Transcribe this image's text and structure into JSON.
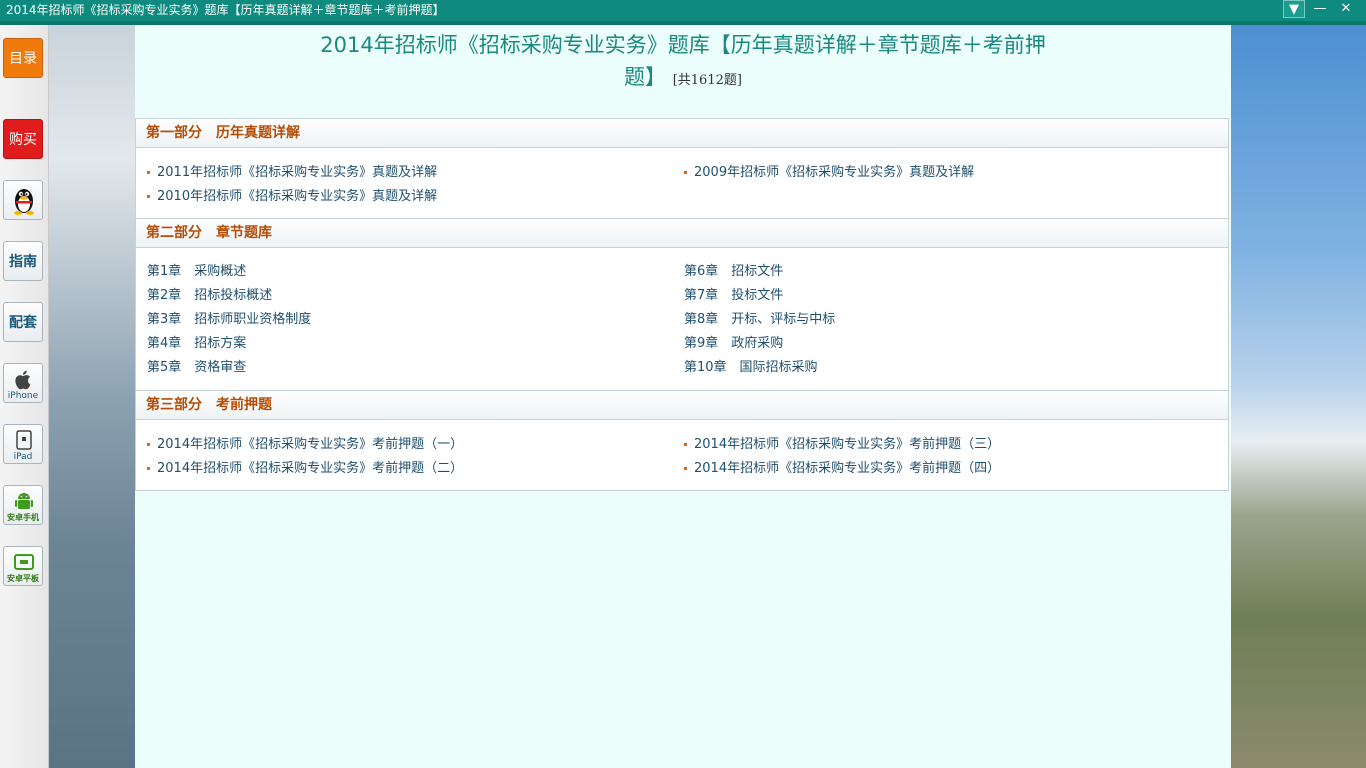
{
  "window": {
    "title": "2014年招标师《招标采购专业实务》题库【历年真题详解＋章节题库＋考前押题】",
    "menu_icon": "▼",
    "minimize_icon": "—",
    "close_icon": "✕"
  },
  "toolbar": {
    "catalog": "目录",
    "buy": "购买",
    "qq_icon": "qq-penguin-icon",
    "guide": "指南",
    "bundle": "配套",
    "iphone": "iPhone",
    "ipad": "iPad",
    "android_phone": "安卓手机",
    "android_tablet": "安卓平板"
  },
  "header": {
    "title_line1": "2014年招标师《招标采购专业实务》题库【历年真题详解＋章节题库＋考前押",
    "title_line2": "题】",
    "count": "[共1612题]"
  },
  "sections": [
    {
      "heading": "第一部分　历年真题详解",
      "items": [
        "2011年招标师《招标采购专业实务》真题及详解",
        "2009年招标师《招标采购专业实务》真题及详解",
        "2010年招标师《招标采购专业实务》真题及详解"
      ]
    },
    {
      "heading": "第二部分　章节题库",
      "items": [
        "第1章　采购概述",
        "第6章　招标文件",
        "第2章　招标投标概述",
        "第7章　投标文件",
        "第3章　招标师职业资格制度",
        "第8章　开标、评标与中标",
        "第4章　招标方案",
        "第9章　政府采购",
        "第5章　资格审查",
        "第10章　国际招标采购"
      ]
    },
    {
      "heading": "第三部分　考前押题",
      "items": [
        "2014年招标师《招标采购专业实务》考前押题（一）",
        "2014年招标师《招标采购专业实务》考前押题（三）",
        "2014年招标师《招标采购专业实务》考前押题（二）",
        "2014年招标师《招标采购专业实务》考前押题（四）"
      ]
    }
  ],
  "colors": {
    "titlebar": "#0e8a7e",
    "title_text": "#19897f",
    "section_heading": "#b54d06",
    "link_text": "#1f4f6e",
    "panel_bg": "#ecfefc"
  }
}
